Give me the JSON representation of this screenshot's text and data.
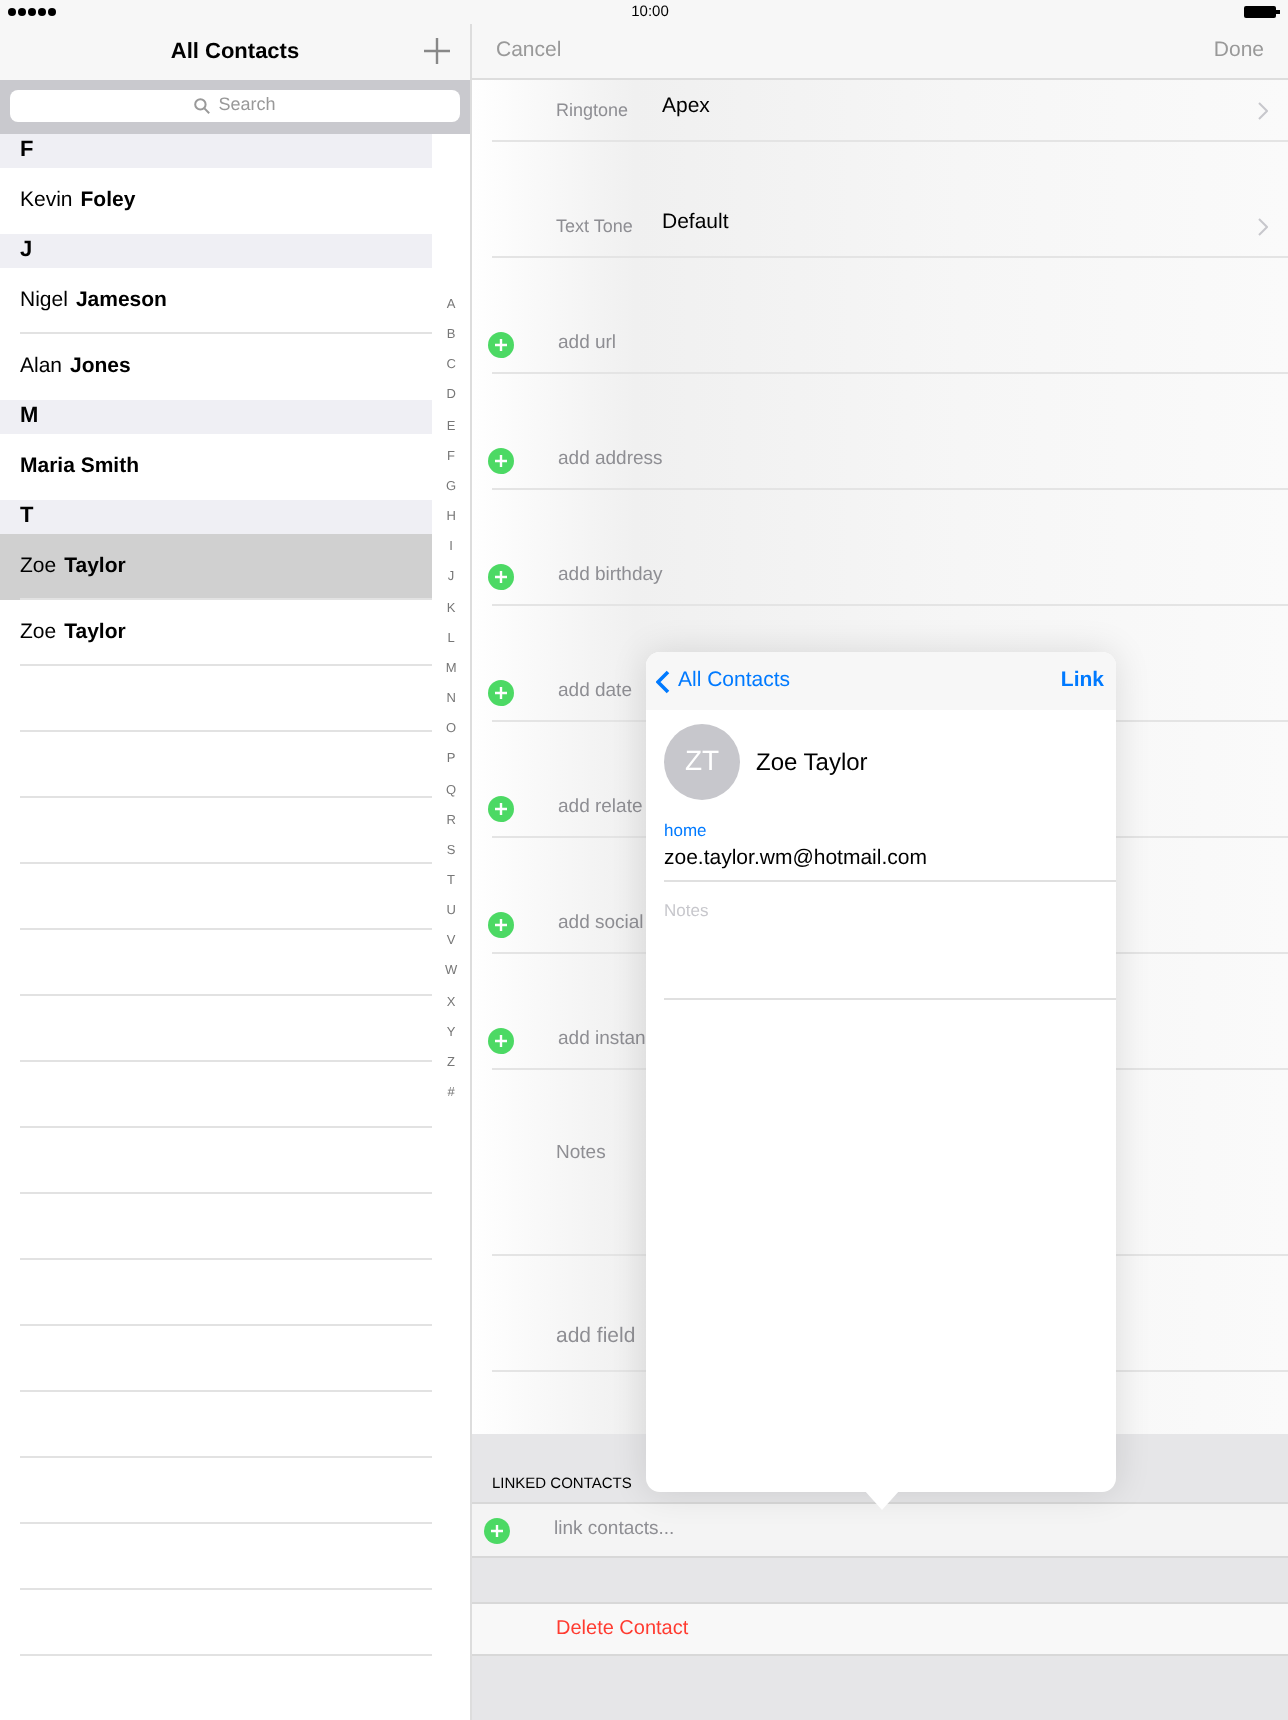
{
  "status_bar": {
    "time": "10:00"
  },
  "contacts_panel": {
    "title": "All Contacts",
    "search": {
      "placeholder": "Search"
    },
    "sections": [
      {
        "letter": "F",
        "contacts": [
          {
            "kind": "person",
            "first": "Kevin",
            "last": "Foley",
            "selected": false
          }
        ]
      },
      {
        "letter": "J",
        "contacts": [
          {
            "kind": "person",
            "first": "Nigel",
            "last": "Jameson",
            "selected": false
          },
          {
            "kind": "person",
            "first": "Alan",
            "last": "Jones",
            "selected": false
          }
        ]
      },
      {
        "letter": "M",
        "contacts": [
          {
            "kind": "company",
            "name": "Maria Smith",
            "selected": false
          }
        ]
      },
      {
        "letter": "T",
        "contacts": [
          {
            "kind": "person",
            "first": "Zoe",
            "last": "Taylor",
            "selected": true
          },
          {
            "kind": "person",
            "first": "Zoe",
            "last": "Taylor",
            "selected": false
          }
        ]
      }
    ],
    "index": [
      "A",
      "B",
      "C",
      "D",
      "E",
      "F",
      "G",
      "H",
      "I",
      "J",
      "K",
      "L",
      "M",
      "N",
      "O",
      "P",
      "Q",
      "R",
      "S",
      "T",
      "U",
      "V",
      "W",
      "X",
      "Y",
      "Z",
      "#"
    ]
  },
  "editor": {
    "cancel": "Cancel",
    "done": "Done",
    "rows": [
      {
        "kind": "setting",
        "label": "Ringtone",
        "value": "Apex"
      },
      {
        "kind": "setting",
        "label": "Text Tone",
        "value": "Default"
      },
      {
        "kind": "add",
        "label": "add url"
      },
      {
        "kind": "add",
        "label": "add address"
      },
      {
        "kind": "add",
        "label": "add birthday"
      },
      {
        "kind": "add",
        "label": "add date"
      },
      {
        "kind": "add",
        "label": "add relate"
      },
      {
        "kind": "add",
        "label": "add social"
      },
      {
        "kind": "add",
        "label": "add instan"
      },
      {
        "kind": "notes",
        "placeholder": "Notes"
      },
      {
        "kind": "field",
        "label": "add field"
      }
    ],
    "linked_header": "LINKED CONTACTS",
    "link_row": "link contacts...",
    "delete": "Delete Contact"
  },
  "popover": {
    "back": "All Contacts",
    "action": "Link",
    "initials": "ZT",
    "name": "Zoe Taylor",
    "email_label": "home",
    "email": "zoe.taylor.wm@hotmail.com",
    "notes_placeholder": "Notes"
  }
}
